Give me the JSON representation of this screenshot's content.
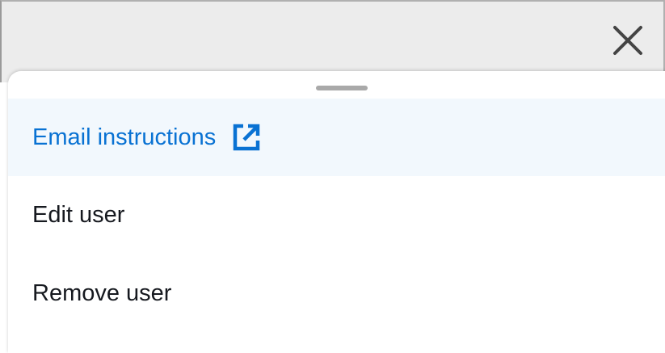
{
  "header": {
    "close_icon": "close-icon"
  },
  "sheet": {
    "handle_icon": "drag-handle"
  },
  "menu": {
    "items": [
      {
        "label": "Email instructions",
        "icon": "external-link-icon",
        "highlighted": true
      },
      {
        "label": "Edit user"
      },
      {
        "label": "Remove user"
      }
    ]
  },
  "colors": {
    "accent": "#0972d3",
    "highlight_bg": "#f2f8fd",
    "text": "#16191f",
    "top_bar_bg": "#ececec"
  }
}
